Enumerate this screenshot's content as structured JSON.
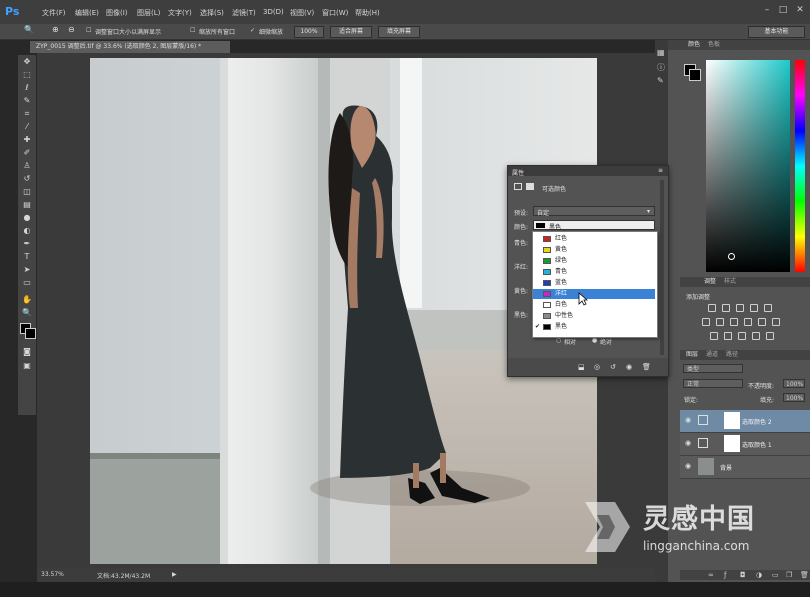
{
  "app": {
    "logo": "Ps"
  },
  "menubar": {
    "items": [
      "文件(F)",
      "编辑(E)",
      "图像(I)",
      "图层(L)",
      "文字(Y)",
      "选择(S)",
      "滤镜(T)",
      "3D(D)",
      "视图(V)",
      "窗口(W)",
      "帮助(H)"
    ],
    "workspace": "基本功能"
  },
  "options_bar": {
    "resize_windows": "调整窗口大小以满屏显示",
    "zoom_all": "缩放所有窗口",
    "scrubby_zoom": "细微缩放",
    "zoom_100": "100%",
    "fit_screen": "适合屏幕",
    "fill_screen": "填充屏幕"
  },
  "document": {
    "tab_title": "ZYP_0015 调整后.tif @ 33.6% (选取颜色 2, 图层蒙版/16) *",
    "zoom": "33.57%",
    "doc_size": "文档:43.2M/43.2M"
  },
  "properties_dialog": {
    "tab": "属性",
    "title": "可选颜色",
    "preset_label": "预设:",
    "preset_value": "自定",
    "colors_label": "颜色:",
    "colors_value": "黑色",
    "cyan_label": "青色:",
    "magenta_label": "洋红:",
    "yellow_label": "黄色:",
    "black_label": "黑色:",
    "relative": "相对",
    "absolute": "绝对"
  },
  "color_menu": {
    "items": [
      {
        "label": "红色",
        "color": "#d42020",
        "selected": false,
        "checked": false
      },
      {
        "label": "黄色",
        "color": "#e8d61c",
        "selected": false,
        "checked": false
      },
      {
        "label": "绿色",
        "color": "#1a9a2a",
        "selected": false,
        "checked": false
      },
      {
        "label": "青色",
        "color": "#22b4d8",
        "selected": false,
        "checked": false
      },
      {
        "label": "蓝色",
        "color": "#1f3fb8",
        "selected": false,
        "checked": false
      },
      {
        "label": "洋红",
        "color": "#c32ac3",
        "selected": true,
        "checked": false
      },
      {
        "label": "白色",
        "color": "#ffffff",
        "selected": false,
        "checked": false
      },
      {
        "label": "中性色",
        "color": "#8a8a8a",
        "selected": false,
        "checked": false
      },
      {
        "label": "黑色",
        "color": "#000000",
        "selected": false,
        "checked": true
      }
    ]
  },
  "color_panel": {
    "tabs": [
      "颜色",
      "色板"
    ]
  },
  "adjustments_panel": {
    "tabs": [
      "调整",
      "样式"
    ],
    "title": "添加调整"
  },
  "layers_panel": {
    "tabs": [
      "图层",
      "通道",
      "路径"
    ],
    "filter": "类型",
    "blend_mode": "正常",
    "opacity_label": "不透明度:",
    "opacity": "100%",
    "lock_label": "锁定:",
    "fill_label": "填充:",
    "fill": "100%",
    "layers": [
      {
        "name": "选取颜色 2",
        "selected": true
      },
      {
        "name": "选取颜色 1",
        "selected": false
      },
      {
        "name": "背景",
        "selected": false
      }
    ]
  },
  "watermark": {
    "cn": "灵感中国",
    "url": "lingganchina.com"
  }
}
